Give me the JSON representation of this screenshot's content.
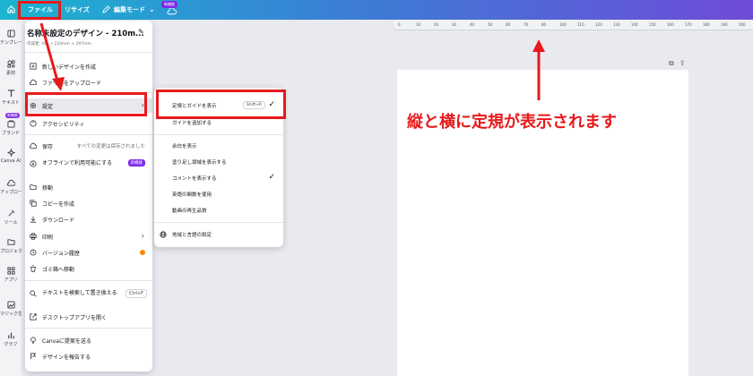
{
  "topbar": {
    "file_label": "ファイル",
    "resize_label": "リサイズ",
    "edit_mode_label": "編集モード",
    "new_badge": "新機能"
  },
  "rail": {
    "items": [
      "テンプレート",
      "素材",
      "テキスト",
      "ブランド",
      "Canva AI",
      "アップロード",
      "ツール",
      "プロジェクト",
      "アプリ",
      "マジック生成",
      "グラフ"
    ],
    "new_badge": "新機能"
  },
  "menu": {
    "design_title": "名称未設定のデザイン - 210m...",
    "design_sub": "作成者: Ai... • 210mm × 297mm",
    "items": {
      "new_design": "新しいデザインを作成",
      "upload": "ファイルをアップロード",
      "settings": "設定",
      "accessibility": "アクセシビリティ",
      "save": "保存",
      "save_status": "すべての変更は保存されました",
      "offline": "オフラインで利用可能にする",
      "offline_badge": "新機能",
      "move": "移動",
      "copy": "コピーを作成",
      "download": "ダウンロード",
      "print": "印刷",
      "version_history": "バージョン履歴",
      "trash": "ゴミ箱へ移動",
      "find_replace": "テキストを検索して置き換える",
      "find_replace_shortcut": "Ctrl+F",
      "desktop_app": "デスクトップアプリを開く",
      "suggest": "Canvaに提案を送る",
      "report": "デザインを報告する"
    }
  },
  "submenu": {
    "show_rulers": "定規とガイドを表示",
    "show_rulers_shortcut": "Shift+R",
    "add_guides": "ガイドを追加する",
    "show_margins": "余白を表示",
    "show_bleed": "塗り足し領域を表示する",
    "show_comments": "コメントを表示する",
    "english_functions": "英語の関数を使用",
    "video_quality": "動画の再生品質",
    "region_language": "地域と言語の設定"
  },
  "ruler": {
    "ticks": [
      "0",
      "10",
      "20",
      "30",
      "40",
      "50",
      "60",
      "70",
      "80",
      "100",
      "110",
      "120",
      "130",
      "140",
      "150",
      "160",
      "170",
      "180",
      "190",
      "200"
    ]
  },
  "annotation": {
    "text": "縦と横に定規が表示されます",
    "color": "#e8191b"
  },
  "colors": {
    "accent_purple": "#7d2ae8",
    "highlight_red": "#e8191b"
  }
}
